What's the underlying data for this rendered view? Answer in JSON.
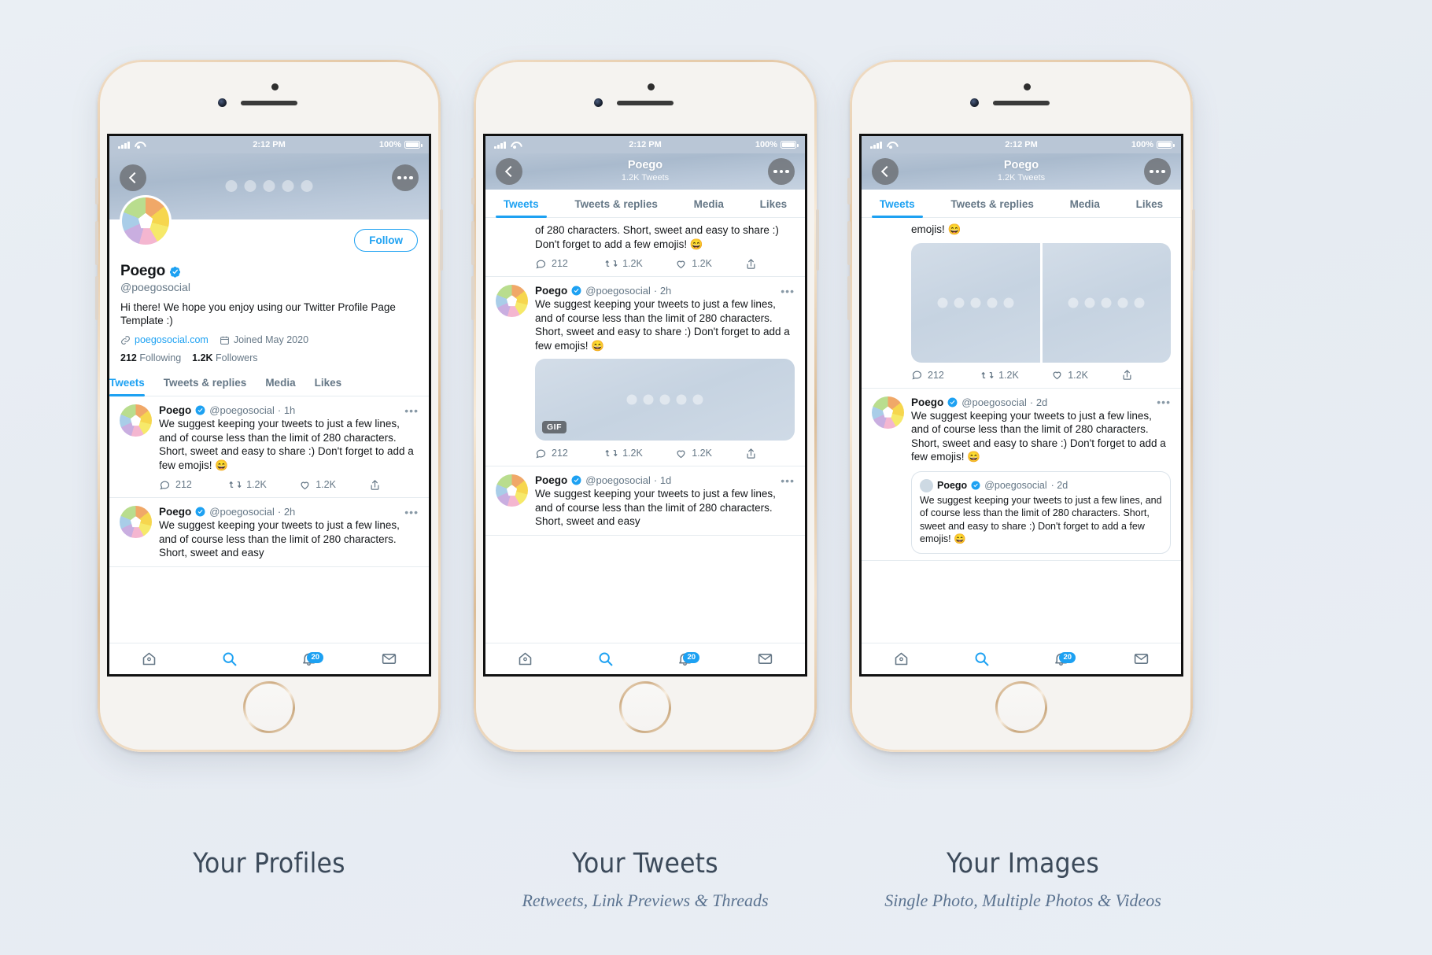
{
  "status_bar": {
    "time": "2:12 PM",
    "battery": "100%"
  },
  "profile": {
    "display_name": "Poego",
    "handle": "@poegosocial",
    "bio": "Hi there! We hope you enjoy using our Twitter Profile Page Template :)",
    "website": "poegosocial.com",
    "joined": "Joined May 2020",
    "following_count": "212",
    "following_label": "Following",
    "followers_count": "1.2K",
    "followers_label": "Followers",
    "follow_button": "Follow",
    "header_subtitle": "1.2K Tweets"
  },
  "tabs": [
    {
      "label": "Tweets",
      "active": true
    },
    {
      "label": "Tweets & replies",
      "active": false
    },
    {
      "label": "Media",
      "active": false
    },
    {
      "label": "Likes",
      "active": false
    }
  ],
  "tweet_text": "We suggest keeping your tweets to just a few lines, and of course less than the limit of 280 characters. Short, sweet and easy to share :) Don't forget to add a few emojis! 😄",
  "tweet_text_partial": "of 280 characters. Short, sweet and easy to share :) Don't forget to add a few emojis! 😄",
  "tweet_text_emoji_only": "emojis! 😄",
  "tweet_text_truncated": "We suggest keeping your tweets to just a few lines, and of course less than the limit of 280 characters. Short, sweet and easy",
  "quote_text": "We suggest keeping your tweets to just a few lines, and of course less than the limit of 280 characters. Short, sweet and easy to share :) Don't forget to add a few emojis! 😄",
  "actions": {
    "replies": "212",
    "retweets": "1.2K",
    "likes": "1.2K"
  },
  "gif_tag": "GIF",
  "nav_badge": "20",
  "phone1": {
    "tweets": [
      {
        "name": "Poego",
        "handle": "@poegosocial",
        "time": "1h"
      },
      {
        "name": "Poego",
        "handle": "@poegosocial",
        "time": "2h"
      }
    ]
  },
  "phone2": {
    "tweets": [
      {
        "name": "Poego",
        "handle": "@poegosocial",
        "time": "2h"
      },
      {
        "name": "Poego",
        "handle": "@poegosocial",
        "time": "1d"
      }
    ]
  },
  "phone3": {
    "tweets": [
      {
        "name": "Poego",
        "handle": "@poegosocial",
        "time": "2d"
      }
    ],
    "quote": {
      "name": "Poego",
      "handle": "@poegosocial",
      "time": "2d"
    }
  },
  "captions": [
    {
      "title": "Your Profiles",
      "subtitle": ""
    },
    {
      "title": "Your Tweets",
      "subtitle": "Retweets, Link Previews & Threads"
    },
    {
      "title": "Your Images",
      "subtitle": "Single Photo, Multiple Photos & Videos"
    }
  ],
  "colors": {
    "accent": "#1da1f2",
    "text": "#14171a",
    "muted": "#657786",
    "caption": "#3c4a5a",
    "subcaption": "#5b7390"
  }
}
